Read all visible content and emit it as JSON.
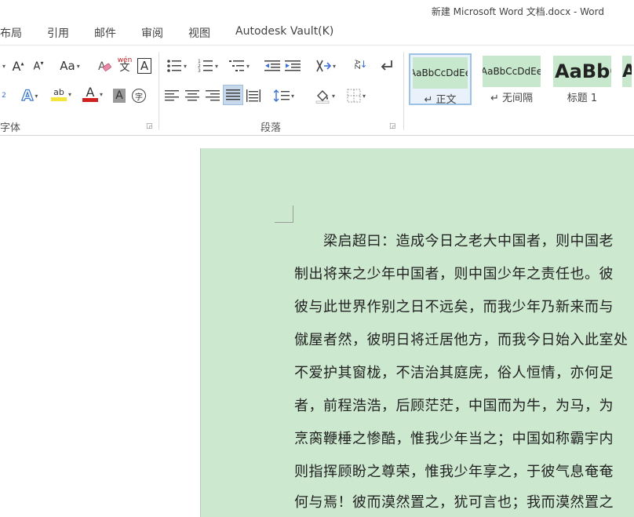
{
  "window": {
    "title": "新建 Microsoft Word 文档.docx - Word"
  },
  "tabs": [
    "布局",
    "引用",
    "邮件",
    "审阅",
    "视图",
    "Autodesk Vault(K)"
  ],
  "ribbon": {
    "font_group": {
      "label": "字体",
      "change_case_label": "Aa",
      "phonetic_top": "wén",
      "phonetic_bottom": "文",
      "border_char": "A",
      "grow_char": "A",
      "shrink_char": "A",
      "text_effect_char": "A",
      "highlight_char": "ab",
      "font_color_char": "A",
      "shading_char": "A",
      "enclose_char": "字",
      "sub_marker": "2",
      "colors": {
        "highlight": "#f5e43a",
        "font_color": "#d02020"
      }
    },
    "paragraph_group": {
      "label": "段落",
      "sort_label": "AZ"
    },
    "styles_group": {
      "cards": [
        {
          "sample": "AaBbCcDdEe",
          "name": "↵ 正文"
        },
        {
          "sample": "AaBbCcDdEe",
          "name": "↵ 无间隔"
        },
        {
          "sample": "AaBbC",
          "name": "标题 1"
        },
        {
          "sample": "A",
          "name": ""
        }
      ]
    }
  },
  "document": {
    "background": "#cce8cf",
    "lines": [
      "　　梁启超曰：造成今日之老大中国者，则中国老",
      "制出将来之少年中国者，则中国少年之责任也。彼",
      "彼与此世界作别之日不远矣，而我少年乃新来而与",
      "僦屋者然，彼明日将迁居他方，而我今日始入此室处",
      "不爱护其窗栊，不洁治其庭庑，俗人恒情，亦何足",
      "者，前程浩浩，后顾茫茫，中国而为牛，为马，为",
      "烹脔鞭棰之惨酷，惟我少年当之；中国如称霸宇内",
      "则指挥顾盼之尊荣，惟我少年享之，于彼气息奄奄",
      "何与焉！彼而漠然置之，犹可言也；我而漠然置之"
    ]
  }
}
